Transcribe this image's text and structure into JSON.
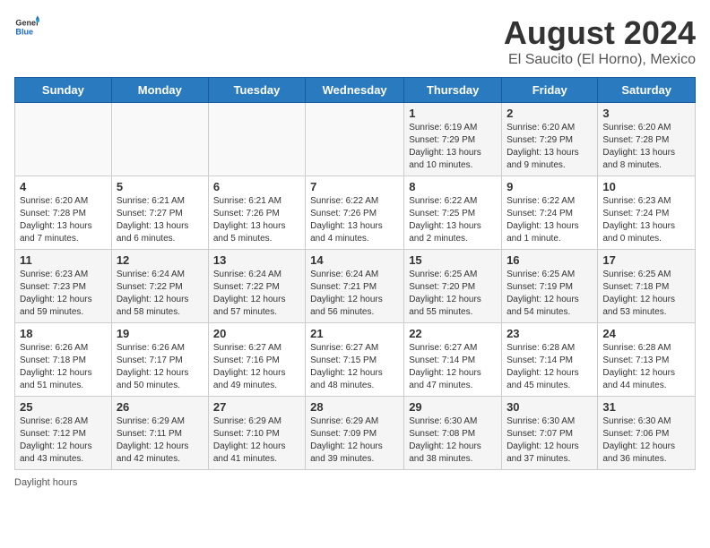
{
  "header": {
    "logo_general": "General",
    "logo_blue": "Blue",
    "main_title": "August 2024",
    "subtitle": "El Saucito (El Horno), Mexico"
  },
  "calendar": {
    "days_of_week": [
      "Sunday",
      "Monday",
      "Tuesday",
      "Wednesday",
      "Thursday",
      "Friday",
      "Saturday"
    ],
    "weeks": [
      [
        {
          "day": "",
          "sunrise": "",
          "sunset": "",
          "daylight": ""
        },
        {
          "day": "",
          "sunrise": "",
          "sunset": "",
          "daylight": ""
        },
        {
          "day": "",
          "sunrise": "",
          "sunset": "",
          "daylight": ""
        },
        {
          "day": "",
          "sunrise": "",
          "sunset": "",
          "daylight": ""
        },
        {
          "day": "1",
          "sunrise": "Sunrise: 6:19 AM",
          "sunset": "Sunset: 7:29 PM",
          "daylight": "Daylight: 13 hours and 10 minutes."
        },
        {
          "day": "2",
          "sunrise": "Sunrise: 6:20 AM",
          "sunset": "Sunset: 7:29 PM",
          "daylight": "Daylight: 13 hours and 9 minutes."
        },
        {
          "day": "3",
          "sunrise": "Sunrise: 6:20 AM",
          "sunset": "Sunset: 7:28 PM",
          "daylight": "Daylight: 13 hours and 8 minutes."
        }
      ],
      [
        {
          "day": "4",
          "sunrise": "Sunrise: 6:20 AM",
          "sunset": "Sunset: 7:28 PM",
          "daylight": "Daylight: 13 hours and 7 minutes."
        },
        {
          "day": "5",
          "sunrise": "Sunrise: 6:21 AM",
          "sunset": "Sunset: 7:27 PM",
          "daylight": "Daylight: 13 hours and 6 minutes."
        },
        {
          "day": "6",
          "sunrise": "Sunrise: 6:21 AM",
          "sunset": "Sunset: 7:26 PM",
          "daylight": "Daylight: 13 hours and 5 minutes."
        },
        {
          "day": "7",
          "sunrise": "Sunrise: 6:22 AM",
          "sunset": "Sunset: 7:26 PM",
          "daylight": "Daylight: 13 hours and 4 minutes."
        },
        {
          "day": "8",
          "sunrise": "Sunrise: 6:22 AM",
          "sunset": "Sunset: 7:25 PM",
          "daylight": "Daylight: 13 hours and 2 minutes."
        },
        {
          "day": "9",
          "sunrise": "Sunrise: 6:22 AM",
          "sunset": "Sunset: 7:24 PM",
          "daylight": "Daylight: 13 hours and 1 minute."
        },
        {
          "day": "10",
          "sunrise": "Sunrise: 6:23 AM",
          "sunset": "Sunset: 7:24 PM",
          "daylight": "Daylight: 13 hours and 0 minutes."
        }
      ],
      [
        {
          "day": "11",
          "sunrise": "Sunrise: 6:23 AM",
          "sunset": "Sunset: 7:23 PM",
          "daylight": "Daylight: 12 hours and 59 minutes."
        },
        {
          "day": "12",
          "sunrise": "Sunrise: 6:24 AM",
          "sunset": "Sunset: 7:22 PM",
          "daylight": "Daylight: 12 hours and 58 minutes."
        },
        {
          "day": "13",
          "sunrise": "Sunrise: 6:24 AM",
          "sunset": "Sunset: 7:22 PM",
          "daylight": "Daylight: 12 hours and 57 minutes."
        },
        {
          "day": "14",
          "sunrise": "Sunrise: 6:24 AM",
          "sunset": "Sunset: 7:21 PM",
          "daylight": "Daylight: 12 hours and 56 minutes."
        },
        {
          "day": "15",
          "sunrise": "Sunrise: 6:25 AM",
          "sunset": "Sunset: 7:20 PM",
          "daylight": "Daylight: 12 hours and 55 minutes."
        },
        {
          "day": "16",
          "sunrise": "Sunrise: 6:25 AM",
          "sunset": "Sunset: 7:19 PM",
          "daylight": "Daylight: 12 hours and 54 minutes."
        },
        {
          "day": "17",
          "sunrise": "Sunrise: 6:25 AM",
          "sunset": "Sunset: 7:18 PM",
          "daylight": "Daylight: 12 hours and 53 minutes."
        }
      ],
      [
        {
          "day": "18",
          "sunrise": "Sunrise: 6:26 AM",
          "sunset": "Sunset: 7:18 PM",
          "daylight": "Daylight: 12 hours and 51 minutes."
        },
        {
          "day": "19",
          "sunrise": "Sunrise: 6:26 AM",
          "sunset": "Sunset: 7:17 PM",
          "daylight": "Daylight: 12 hours and 50 minutes."
        },
        {
          "day": "20",
          "sunrise": "Sunrise: 6:27 AM",
          "sunset": "Sunset: 7:16 PM",
          "daylight": "Daylight: 12 hours and 49 minutes."
        },
        {
          "day": "21",
          "sunrise": "Sunrise: 6:27 AM",
          "sunset": "Sunset: 7:15 PM",
          "daylight": "Daylight: 12 hours and 48 minutes."
        },
        {
          "day": "22",
          "sunrise": "Sunrise: 6:27 AM",
          "sunset": "Sunset: 7:14 PM",
          "daylight": "Daylight: 12 hours and 47 minutes."
        },
        {
          "day": "23",
          "sunrise": "Sunrise: 6:28 AM",
          "sunset": "Sunset: 7:14 PM",
          "daylight": "Daylight: 12 hours and 45 minutes."
        },
        {
          "day": "24",
          "sunrise": "Sunrise: 6:28 AM",
          "sunset": "Sunset: 7:13 PM",
          "daylight": "Daylight: 12 hours and 44 minutes."
        }
      ],
      [
        {
          "day": "25",
          "sunrise": "Sunrise: 6:28 AM",
          "sunset": "Sunset: 7:12 PM",
          "daylight": "Daylight: 12 hours and 43 minutes."
        },
        {
          "day": "26",
          "sunrise": "Sunrise: 6:29 AM",
          "sunset": "Sunset: 7:11 PM",
          "daylight": "Daylight: 12 hours and 42 minutes."
        },
        {
          "day": "27",
          "sunrise": "Sunrise: 6:29 AM",
          "sunset": "Sunset: 7:10 PM",
          "daylight": "Daylight: 12 hours and 41 minutes."
        },
        {
          "day": "28",
          "sunrise": "Sunrise: 6:29 AM",
          "sunset": "Sunset: 7:09 PM",
          "daylight": "Daylight: 12 hours and 39 minutes."
        },
        {
          "day": "29",
          "sunrise": "Sunrise: 6:30 AM",
          "sunset": "Sunset: 7:08 PM",
          "daylight": "Daylight: 12 hours and 38 minutes."
        },
        {
          "day": "30",
          "sunrise": "Sunrise: 6:30 AM",
          "sunset": "Sunset: 7:07 PM",
          "daylight": "Daylight: 12 hours and 37 minutes."
        },
        {
          "day": "31",
          "sunrise": "Sunrise: 6:30 AM",
          "sunset": "Sunset: 7:06 PM",
          "daylight": "Daylight: 12 hours and 36 minutes."
        }
      ]
    ]
  },
  "footer": {
    "note": "Daylight hours"
  }
}
